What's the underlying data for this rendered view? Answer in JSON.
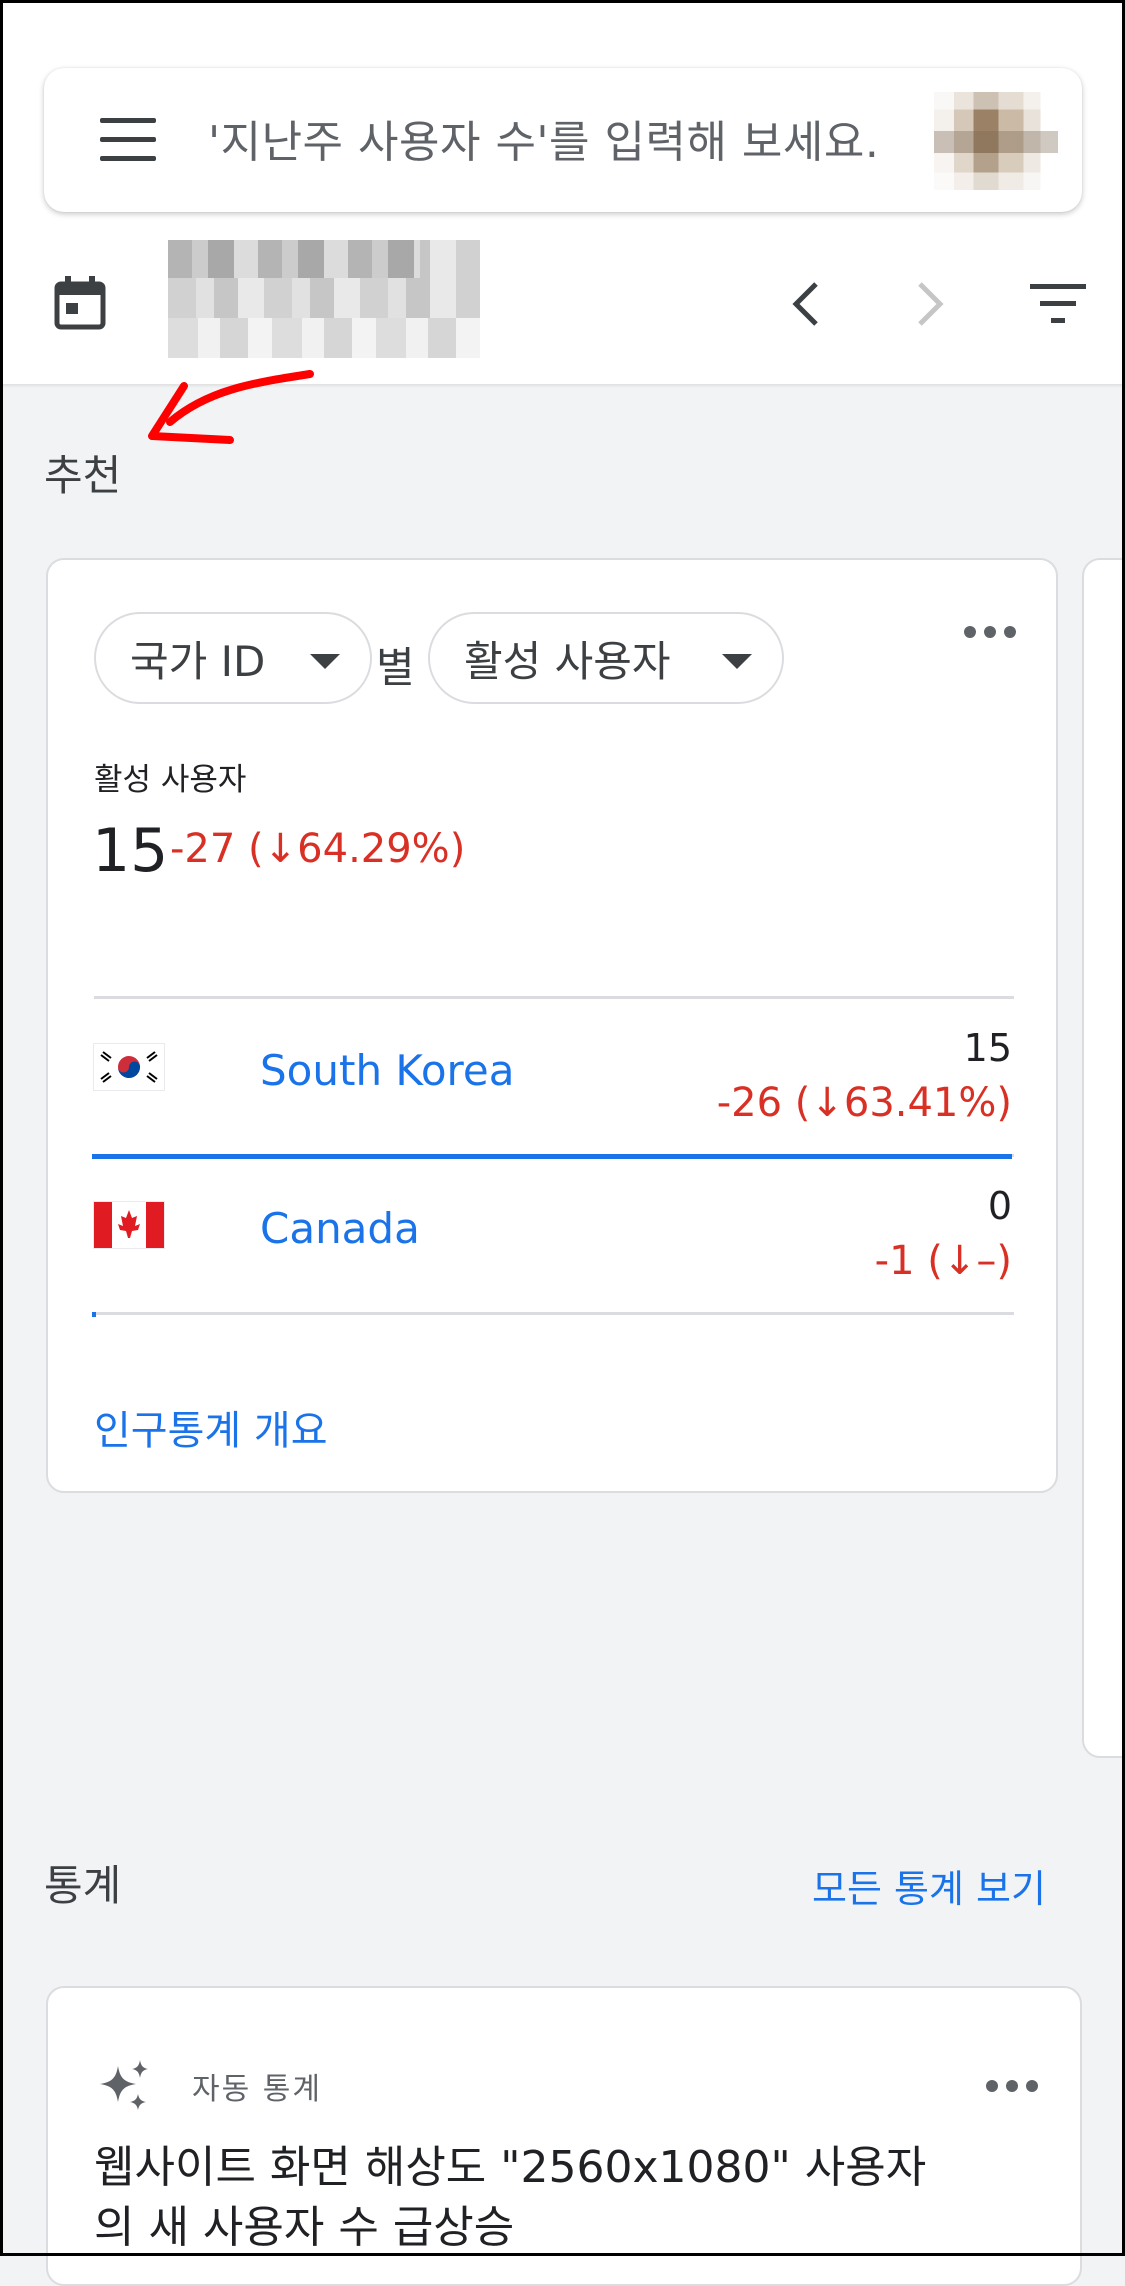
{
  "search": {
    "placeholder": "'지난주 사용자 수'를 입력해 보세요."
  },
  "toolbar": {
    "icons": [
      "hamburger-menu-icon",
      "calendar-icon",
      "chevron-left-icon",
      "chevron-right-icon",
      "filter-icon"
    ]
  },
  "recommendations": {
    "title": "추천",
    "card": {
      "dimension_chip": "국가 ID",
      "by_label": "별",
      "metric_chip": "활성 사용자",
      "metric_label": "활성 사용자",
      "metric_value": "15",
      "metric_delta": "-27 (↓64.29%)",
      "rows": [
        {
          "country": "South Korea",
          "value": "15",
          "delta": "-26 (↓63.41%)",
          "share": 1.0
        },
        {
          "country": "Canada",
          "value": "0",
          "delta": "-1 (↓–)",
          "share": 0.0
        }
      ],
      "link": "인구통계 개요"
    }
  },
  "insights": {
    "title": "통계",
    "view_all": "모든 통계 보기",
    "card": {
      "type_label": "자동 통계",
      "text": "웹사이트 화면 해상도 \"2560x1080\" 사용자의 새 사용자 수 급상승"
    }
  },
  "colors": {
    "accent": "#1a73e8",
    "negative": "#d93025",
    "annotation": "#ff0000"
  }
}
